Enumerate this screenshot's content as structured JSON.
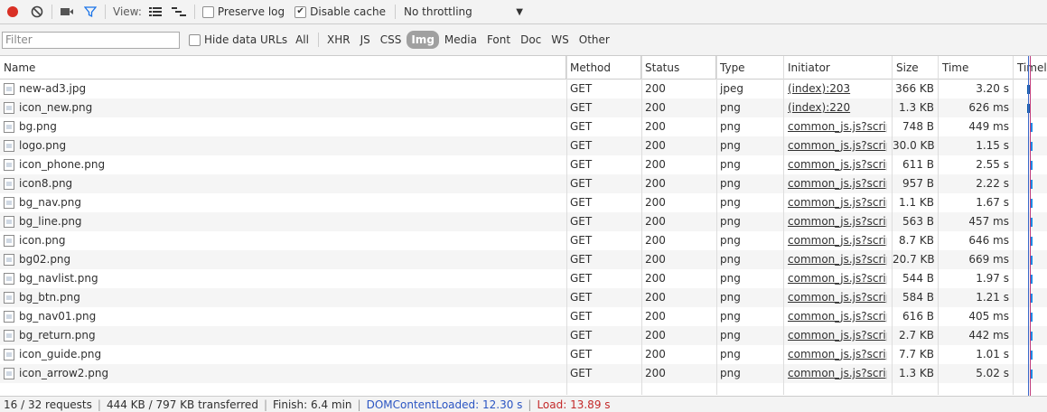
{
  "toolbar": {
    "record_icon": "record-icon",
    "clear_icon": "clear-icon",
    "camera_icon": "camera-icon",
    "filter_icon": "filter-icon",
    "view_label": "View:",
    "preserve_log_label": "Preserve log",
    "disable_cache_label": "Disable cache",
    "disable_cache_checked": true,
    "throttle_value": "No throttling"
  },
  "filterbar": {
    "filter_placeholder": "Filter",
    "hide_data_urls_label": "Hide data URLs",
    "types": [
      "All",
      "XHR",
      "JS",
      "CSS",
      "Img",
      "Media",
      "Font",
      "Doc",
      "WS",
      "Other"
    ],
    "selected_type": "Img"
  },
  "columns": {
    "name": "Name",
    "method": "Method",
    "status": "Status",
    "type": "Type",
    "initiator": "Initiator",
    "size": "Size",
    "time": "Time",
    "timeline": "Timeline"
  },
  "requests": [
    {
      "name": "new-ad3.jpg",
      "method": "GET",
      "status": "200",
      "type": "jpeg",
      "initiator": "(index):203",
      "size": "366 KB",
      "time": "3.20 s"
    },
    {
      "name": "icon_new.png",
      "method": "GET",
      "status": "200",
      "type": "png",
      "initiator": "(index):220",
      "size": "1.3 KB",
      "time": "626 ms"
    },
    {
      "name": "bg.png",
      "method": "GET",
      "status": "200",
      "type": "png",
      "initiator": "common_js.js?scrip...",
      "size": "748 B",
      "time": "449 ms"
    },
    {
      "name": "logo.png",
      "method": "GET",
      "status": "200",
      "type": "png",
      "initiator": "common_js.js?scrip...",
      "size": "30.0 KB",
      "time": "1.15 s"
    },
    {
      "name": "icon_phone.png",
      "method": "GET",
      "status": "200",
      "type": "png",
      "initiator": "common_js.js?scrip...",
      "size": "611 B",
      "time": "2.55 s"
    },
    {
      "name": "icon8.png",
      "method": "GET",
      "status": "200",
      "type": "png",
      "initiator": "common_js.js?scrip...",
      "size": "957 B",
      "time": "2.22 s"
    },
    {
      "name": "bg_nav.png",
      "method": "GET",
      "status": "200",
      "type": "png",
      "initiator": "common_js.js?scrip...",
      "size": "1.1 KB",
      "time": "1.67 s"
    },
    {
      "name": "bg_line.png",
      "method": "GET",
      "status": "200",
      "type": "png",
      "initiator": "common_js.js?scrip...",
      "size": "563 B",
      "time": "457 ms"
    },
    {
      "name": "icon.png",
      "method": "GET",
      "status": "200",
      "type": "png",
      "initiator": "common_js.js?scrip...",
      "size": "8.7 KB",
      "time": "646 ms"
    },
    {
      "name": "bg02.png",
      "method": "GET",
      "status": "200",
      "type": "png",
      "initiator": "common_js.js?scrip...",
      "size": "20.7 KB",
      "time": "669 ms"
    },
    {
      "name": "bg_navlist.png",
      "method": "GET",
      "status": "200",
      "type": "png",
      "initiator": "common_js.js?scrip...",
      "size": "544 B",
      "time": "1.97 s"
    },
    {
      "name": "bg_btn.png",
      "method": "GET",
      "status": "200",
      "type": "png",
      "initiator": "common_js.js?scrip...",
      "size": "584 B",
      "time": "1.21 s"
    },
    {
      "name": "bg_nav01.png",
      "method": "GET",
      "status": "200",
      "type": "png",
      "initiator": "common_js.js?scrip...",
      "size": "616 B",
      "time": "405 ms"
    },
    {
      "name": "bg_return.png",
      "method": "GET",
      "status": "200",
      "type": "png",
      "initiator": "common_js.js?scrip...",
      "size": "2.7 KB",
      "time": "442 ms"
    },
    {
      "name": "icon_guide.png",
      "method": "GET",
      "status": "200",
      "type": "png",
      "initiator": "common_js.js?scrip...",
      "size": "7.7 KB",
      "time": "1.01 s"
    },
    {
      "name": "icon_arrow2.png",
      "method": "GET",
      "status": "200",
      "type": "png",
      "initiator": "common_js.js?scrip...",
      "size": "1.3 KB",
      "time": "5.02 s"
    }
  ],
  "statusbar": {
    "requests": "16 / 32 requests",
    "transferred": "444 KB / 797 KB transferred",
    "finish": "Finish: 6.4 min",
    "dom_content_loaded": "DOMContentLoaded: 12.30 s",
    "load": "Load: 13.89 s"
  },
  "colors": {
    "record": "#d93025",
    "filter_active": "#1a73e8",
    "dom_content_loaded": "#2b55c3",
    "load": "#c42a2a",
    "timeline_bar": "#1e88e5"
  }
}
